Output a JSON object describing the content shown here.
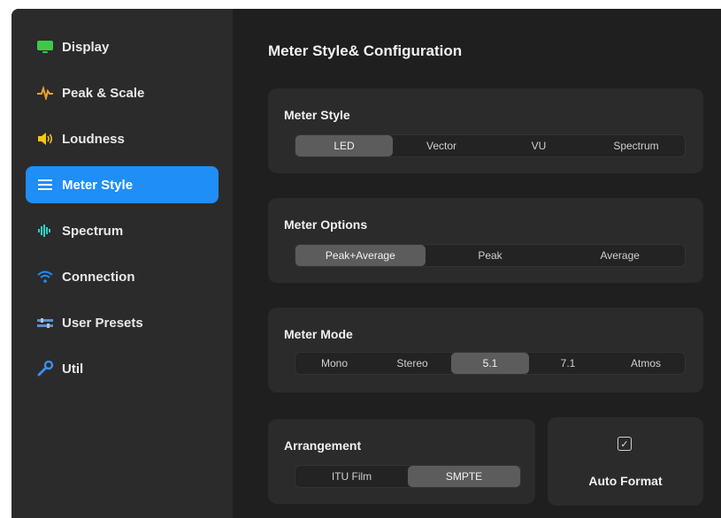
{
  "sidebar": {
    "items": [
      {
        "label": "Display",
        "icon": "monitor-icon",
        "color": "#3cc94a"
      },
      {
        "label": "Peak & Scale",
        "icon": "waveform-icon",
        "color": "#f0a030"
      },
      {
        "label": "Loudness",
        "icon": "speaker-icon",
        "color": "#f5c518"
      },
      {
        "label": "Meter Style",
        "icon": "list-icon",
        "color": "#ffffff",
        "active": true
      },
      {
        "label": "Spectrum",
        "icon": "spectrum-icon",
        "color": "#2fd3c4"
      },
      {
        "label": "Connection",
        "icon": "wifi-icon",
        "color": "#1f8ef7"
      },
      {
        "label": "User Presets",
        "icon": "presets-icon",
        "color": "#5b8fd6"
      },
      {
        "label": "Util",
        "icon": "wrench-icon",
        "color": "#3a8ff0"
      }
    ]
  },
  "main": {
    "title": "Meter Style& Configuration",
    "meter_style": {
      "title": "Meter Style",
      "options": [
        "LED",
        "Vector",
        "VU",
        "Spectrum"
      ],
      "selected": "LED"
    },
    "meter_options": {
      "title": "Meter Options",
      "options": [
        "Peak+Average",
        "Peak",
        "Average"
      ],
      "selected": "Peak+Average"
    },
    "meter_mode": {
      "title": "Meter Mode",
      "options": [
        "Mono",
        "Stereo",
        "5.1",
        "7.1",
        "Atmos"
      ],
      "selected": "5.1"
    },
    "arrangement": {
      "title": "Arrangement",
      "options": [
        "ITU Film",
        "SMPTE"
      ],
      "selected": "SMPTE"
    },
    "auto_format": {
      "label": "Auto Format",
      "checked": true
    }
  }
}
